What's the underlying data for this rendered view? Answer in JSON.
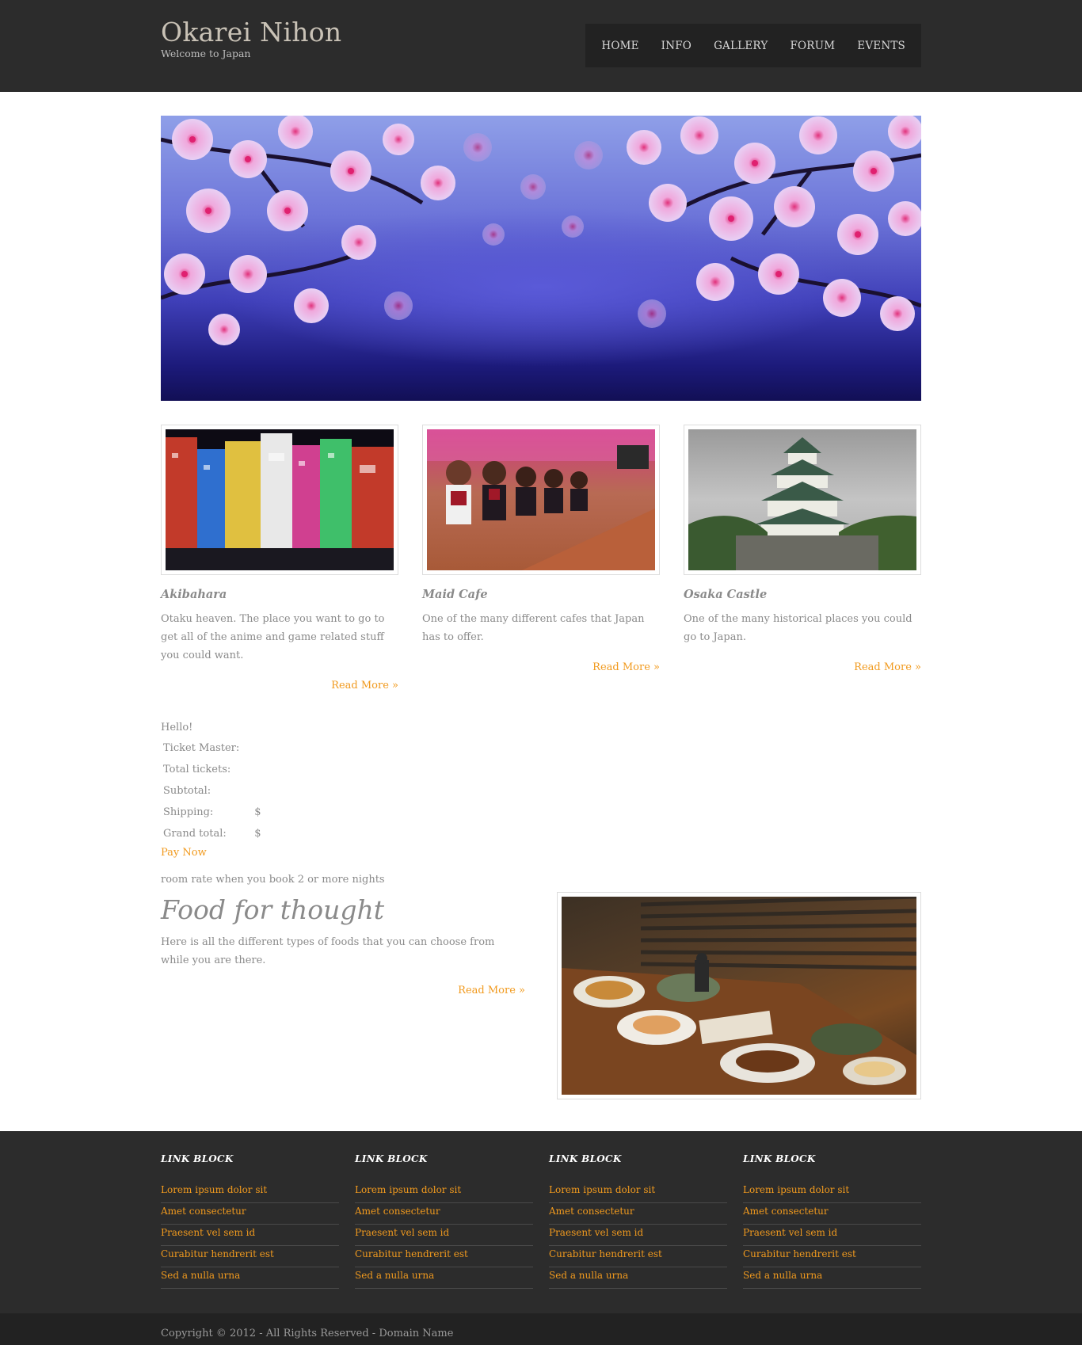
{
  "site": {
    "title": "Okarei Nihon",
    "tagline": "Welcome to Japan"
  },
  "nav": {
    "items": [
      "HOME",
      "INFO",
      "GALLERY",
      "FORUM",
      "EVENTS"
    ]
  },
  "features": [
    {
      "title": "Akibahara",
      "text": "Otaku heaven. The place you want to go to get all of the anime and game related stuff you could want.",
      "link": "Read More »",
      "icon": "akihabara-photo"
    },
    {
      "title": "Maid Cafe",
      "text": "One of the many different cafes that Japan has to offer.",
      "link": "Read More »",
      "icon": "maid-cafe-photo"
    },
    {
      "title": "Osaka Castle",
      "text": "One of the many historical places you could go to Japan.",
      "link": "Read More »",
      "icon": "osaka-castle-photo"
    }
  ],
  "ticket": {
    "greeting": "Hello!",
    "rows": [
      {
        "label": "Ticket Master:",
        "value": ""
      },
      {
        "label": "Total tickets:",
        "value": ""
      },
      {
        "label": "Subtotal:",
        "value": ""
      },
      {
        "label": "Shipping:",
        "value": "$"
      },
      {
        "label": "Grand total:",
        "value": "$"
      }
    ],
    "pay_label": "Pay Now",
    "room_rate": "room rate when you book 2 or more nights"
  },
  "food": {
    "title": "Food for thought",
    "text": "Here is all the different types of foods that you can choose from while you are there.",
    "link": "Read More »"
  },
  "footer": {
    "columns": [
      {
        "heading": "LINK BLOCK",
        "links": [
          "Lorem ipsum dolor sit",
          "Amet consectetur",
          "Praesent vel sem id",
          "Curabitur hendrerit est",
          "Sed a nulla urna"
        ]
      },
      {
        "heading": "LINK BLOCK",
        "links": [
          "Lorem ipsum dolor sit",
          "Amet consectetur",
          "Praesent vel sem id",
          "Curabitur hendrerit est",
          "Sed a nulla urna"
        ]
      },
      {
        "heading": "LINK BLOCK",
        "links": [
          "Lorem ipsum dolor sit",
          "Amet consectetur",
          "Praesent vel sem id",
          "Curabitur hendrerit est",
          "Sed a nulla urna"
        ]
      },
      {
        "heading": "LINK BLOCK",
        "links": [
          "Lorem ipsum dolor sit",
          "Amet consectetur",
          "Praesent vel sem id",
          "Curabitur hendrerit est",
          "Sed a nulla urna"
        ]
      }
    ],
    "copyright": "Copyright © 2012 - All Rights Reserved - Domain Name"
  },
  "colors": {
    "header_bg": "#2c2c2c",
    "accent": "#f19a1e",
    "text": "#8a8a8a"
  }
}
